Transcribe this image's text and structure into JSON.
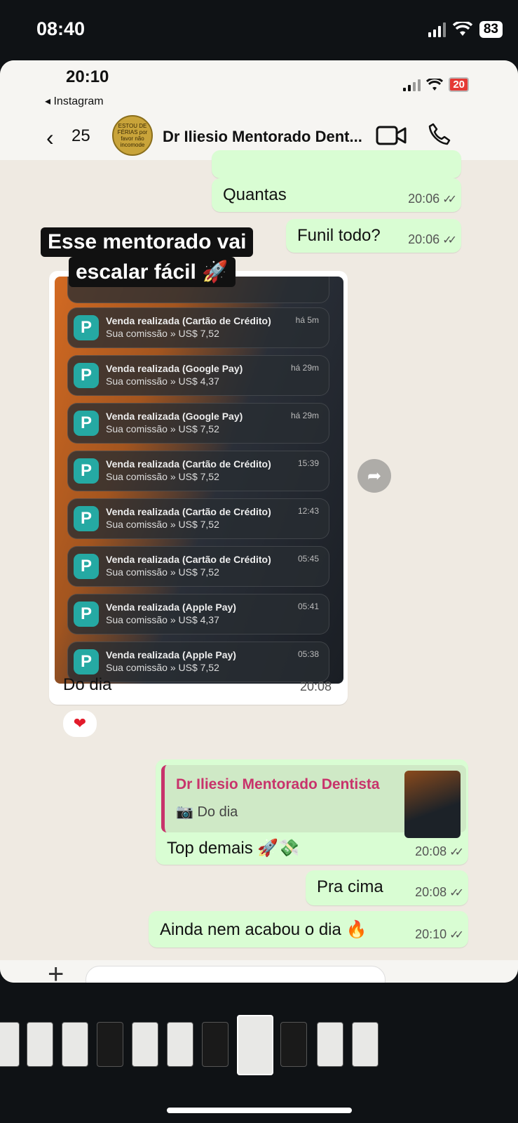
{
  "outer_status": {
    "time": "08:40",
    "battery": "83"
  },
  "inner_status": {
    "time": "20:10",
    "back_app": "◂ Instagram",
    "battery": "20"
  },
  "chat_header": {
    "back_count": "25",
    "title": "Dr Iliesio Mentorado Dent...",
    "avatar_text": "ESTOU DE FÉRIAS por favor não incomode"
  },
  "messages": {
    "m1": {
      "text": "Quantas",
      "time": "20:06"
    },
    "m2": {
      "text": "Funil todo?",
      "time": "20:06"
    },
    "image_msg": {
      "caption_line1": "Esse mentorado vai",
      "caption_line2": "escalar fácil 🚀",
      "text": "Do dia",
      "time": "20:08",
      "reaction": "❤"
    },
    "reply_msg": {
      "quote_name": "Dr Iliesio Mentorado Dentista",
      "quote_text": "📷 Do dia",
      "text": "Top demais 🚀💸",
      "time": "20:08"
    },
    "m5": {
      "text": "Pra cima",
      "time": "20:08"
    },
    "m6": {
      "text": "Ainda nem acabou o dia 🔥",
      "time": "20:10"
    }
  },
  "notifications": [
    {
      "title": "Venda realizada (Cartão de Crédito)",
      "sub": "Sua comissão » US$ 7,52",
      "time": "há 5m"
    },
    {
      "title": "Venda realizada (Google Pay)",
      "sub": "Sua comissão » US$ 4,37",
      "time": "há 29m"
    },
    {
      "title": "Venda realizada (Google Pay)",
      "sub": "Sua comissão » US$ 7,52",
      "time": "há 29m"
    },
    {
      "title": "Venda realizada (Cartão de Crédito)",
      "sub": "Sua comissão » US$ 7,52",
      "time": "15:39"
    },
    {
      "title": "Venda realizada (Cartão de Crédito)",
      "sub": "Sua comissão » US$ 7,52",
      "time": "12:43"
    },
    {
      "title": "Venda realizada (Cartão de Crédito)",
      "sub": "Sua comissão » US$ 7,52",
      "time": "05:45"
    },
    {
      "title": "Venda realizada (Apple Pay)",
      "sub": "Sua comissão » US$ 4,37",
      "time": "05:41"
    },
    {
      "title": "Venda realizada (Apple Pay)",
      "sub": "Sua comissão » US$ 7,52",
      "time": "05:38"
    }
  ],
  "colors": {
    "outgoing_bubble": "#d9fdd3",
    "incoming_bubble": "#ffffff",
    "wallpaper": "#efeae2",
    "quote_accent": "#c8336b",
    "app_icon": "#25a9a3"
  }
}
